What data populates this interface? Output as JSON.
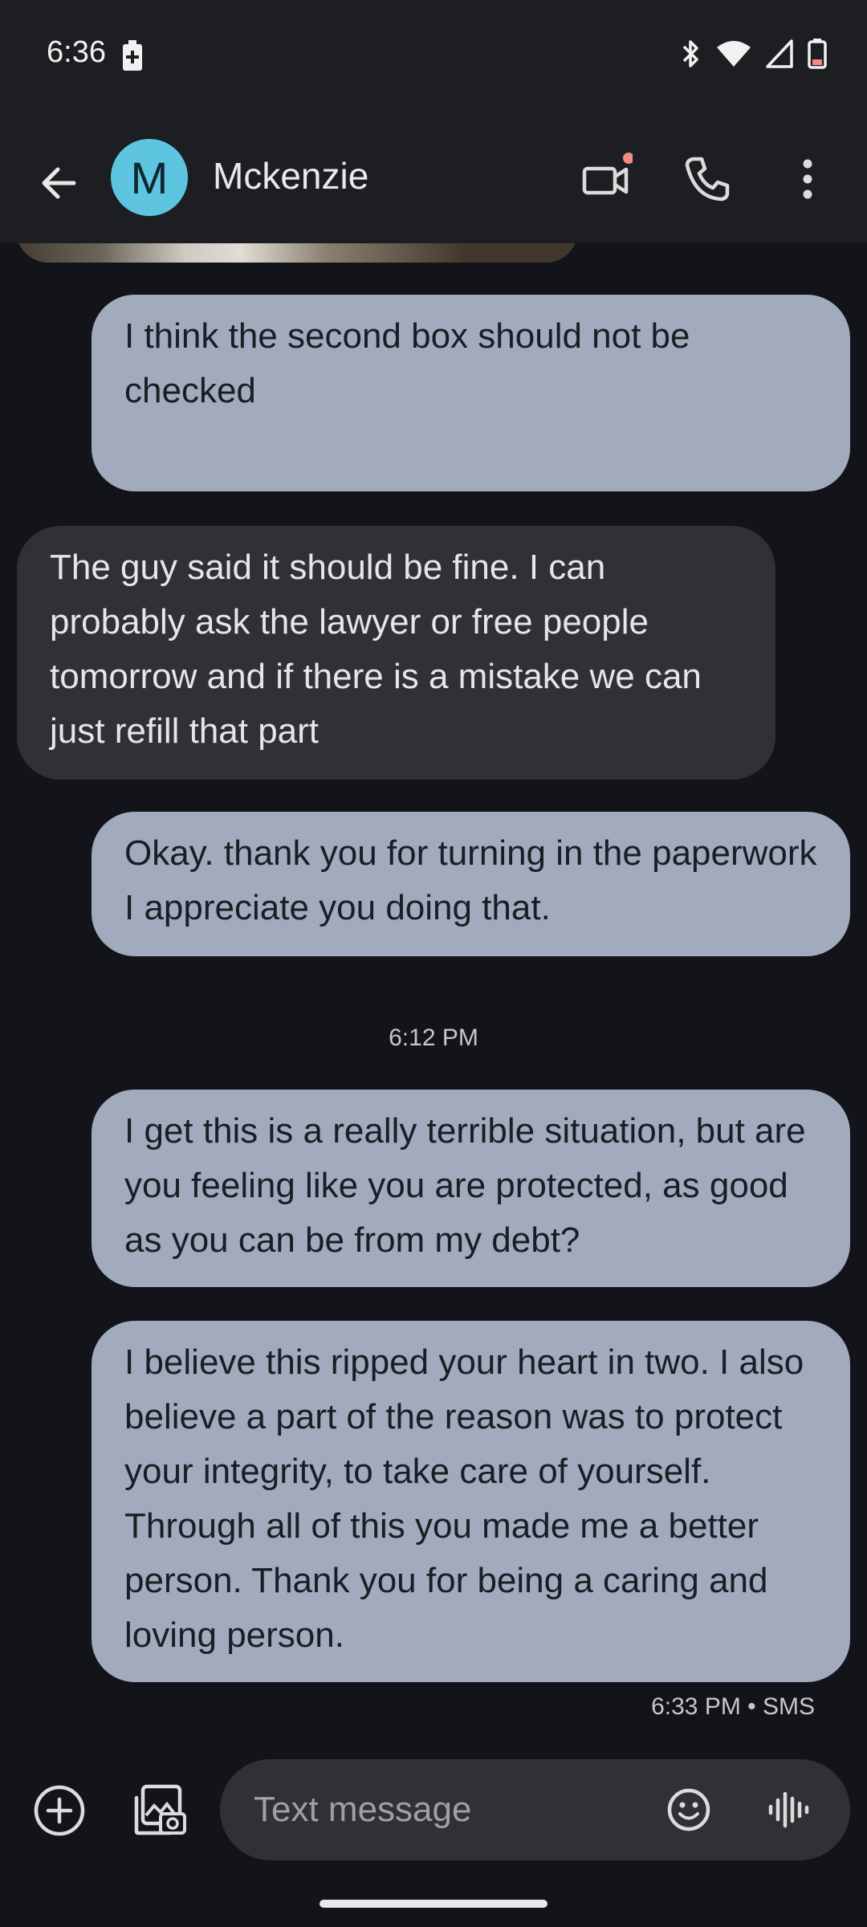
{
  "status_bar": {
    "time": "6:36",
    "icons": [
      "battery-saver-icon",
      "bluetooth-icon",
      "wifi-icon",
      "signal-icon",
      "battery-icon"
    ]
  },
  "app_bar": {
    "avatar_letter": "M",
    "contact_name": "Mckenzie",
    "avatar_color": "#5ec5e1",
    "icons": [
      "back-arrow-icon",
      "video-call-icon",
      "phone-icon",
      "more-vert-icon"
    ]
  },
  "messages": [
    {
      "direction": "outgoing",
      "text": "I think the second box should not be checked"
    },
    {
      "direction": "incoming",
      "text": "The guy said it should be fine. I can probably ask the lawyer or free people tomorrow and if there is a mistake we can just refill that part"
    },
    {
      "direction": "outgoing",
      "text": "Okay. thank you for turning in the paperwork I appreciate you doing that."
    },
    {
      "direction": "timestamp",
      "text": "6:12 PM"
    },
    {
      "direction": "outgoing",
      "text": "I get this is a really terrible situation, but are you feeling like you are protected, as good as you can be from my debt?"
    },
    {
      "direction": "outgoing",
      "text": "I believe this ripped your heart in two. I also believe a part of the reason was to protect your integrity, to take care of yourself. Through all of this you made me a better person. Thank you for being a caring and loving person."
    }
  ],
  "last_message_meta": "6:33 PM • SMS",
  "composer": {
    "placeholder": "Text message",
    "icons": [
      "add-circle-icon",
      "gallery-icon",
      "emoji-icon",
      "voice-waveform-icon"
    ]
  },
  "colors": {
    "background": "#131419",
    "outgoing_bubble": "#a1abbd",
    "incoming_bubble": "#303135",
    "video_badge": "#f28b82"
  }
}
